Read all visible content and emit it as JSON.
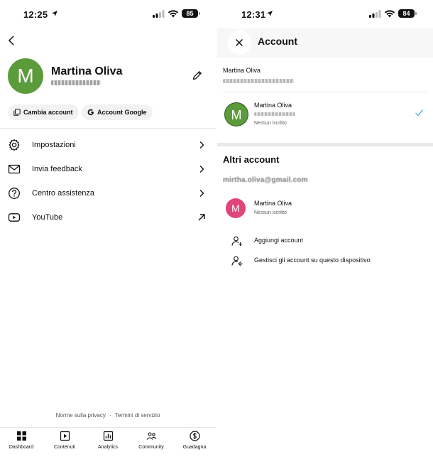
{
  "left": {
    "status": {
      "time": "12:25",
      "battery": "85"
    },
    "profile": {
      "initial": "M",
      "name": "Martina Oliva",
      "avatar_color": "#5b9b3b"
    },
    "chips": {
      "switch_account": "Cambia account",
      "google_account": "Account Google"
    },
    "menu": [
      {
        "label": "Impostazioni",
        "icon": "gear-icon"
      },
      {
        "label": "Invia feedback",
        "icon": "mail-icon"
      },
      {
        "label": "Centro assistenza",
        "icon": "help-icon"
      },
      {
        "label": "YouTube",
        "icon": "youtube-icon"
      }
    ],
    "footer": {
      "privacy": "Norme sulla privacy",
      "sep": "·",
      "terms": "Termini di servizio"
    },
    "nav": [
      {
        "label": "Dashboard",
        "icon": "dashboard-icon"
      },
      {
        "label": "Contenuti",
        "icon": "content-icon"
      },
      {
        "label": "Analytics",
        "icon": "analytics-icon"
      },
      {
        "label": "Community",
        "icon": "community-icon"
      },
      {
        "label": "Guadagna",
        "icon": "earn-icon"
      }
    ]
  },
  "right": {
    "status": {
      "time": "12:31",
      "battery": "84"
    },
    "title": "Account",
    "current": {
      "name": "Martina Oliva"
    },
    "channel": {
      "initial": "M",
      "name": "Martina Oliva",
      "subs": "Nessun iscritto",
      "avatar_color": "#5b9b3b"
    },
    "other": {
      "title": "Altri account",
      "email": "mirtha.oliva@gmail.com",
      "account": {
        "initial": "M",
        "name": "Martina Oliva",
        "subs": "Nessun iscritto",
        "avatar_color": "#e0457b"
      }
    },
    "actions": {
      "add": "Aggiungi account",
      "manage": "Gestisci gli account su questo dispositivo"
    },
    "accent": "#3ea6ff"
  }
}
